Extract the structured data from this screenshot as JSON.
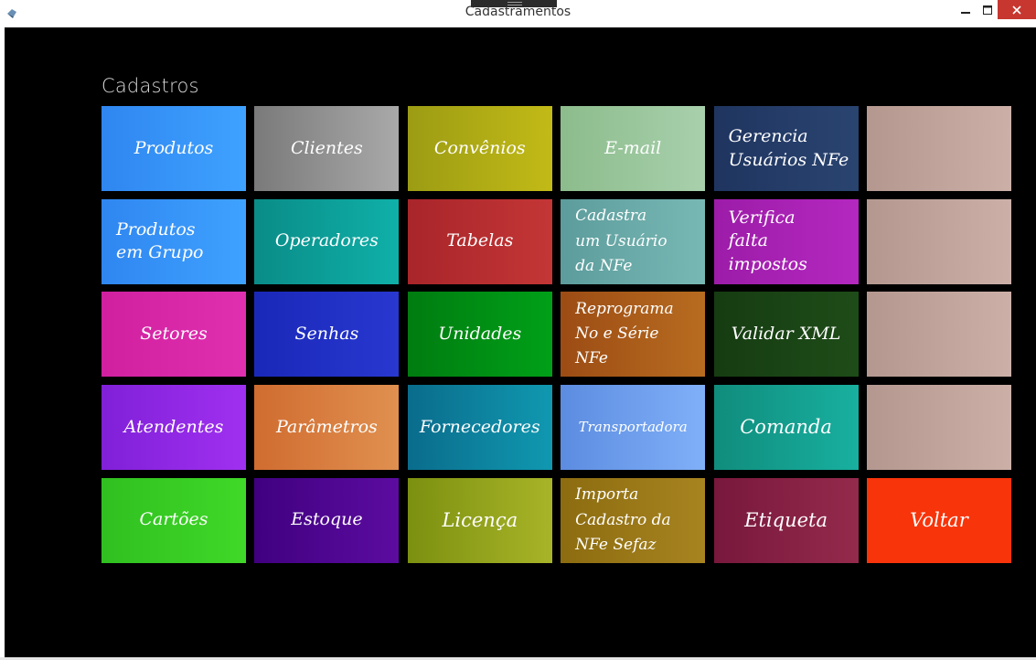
{
  "window": {
    "title": "Cadastramentos"
  },
  "section": {
    "title": "Cadastros"
  },
  "tiles": [
    {
      "label": "Produtos",
      "bg": "linear-gradient(90deg,#2f86f0,#3fa2ff)"
    },
    {
      "label": "Clientes",
      "bg": "linear-gradient(90deg,#7a7a7a,#a9a9a9)"
    },
    {
      "label": "Convênios",
      "bg": "linear-gradient(90deg,#9c9c14,#c2ba16)"
    },
    {
      "label": "E-mail",
      "bg": "linear-gradient(90deg,#8cbc8c,#a8d0ac)"
    },
    {
      "label": "Gerencia\nUsuários NFe",
      "bg": "linear-gradient(90deg,#1f3560,#2a4470)"
    },
    {
      "label": "",
      "bg": "linear-gradient(90deg,#b49890,#ccb0a8)"
    },
    {
      "label": "Produtos\nem Grupo",
      "bg": "linear-gradient(90deg,#2f86f0,#3fa2ff)"
    },
    {
      "label": "Operadores",
      "bg": "linear-gradient(90deg,#0a8c88,#0fb0a8)"
    },
    {
      "label": "Tabelas",
      "bg": "linear-gradient(90deg,#a8252a,#c43636)"
    },
    {
      "label": "Cadastra\num Usuário\nda NFe",
      "bg": "linear-gradient(90deg,#5c9c9c,#78b8b4)"
    },
    {
      "label": "Verifica\nfalta impostos",
      "bg": "linear-gradient(90deg,#9c1ca8,#b428c0)"
    },
    {
      "label": "",
      "bg": "linear-gradient(90deg,#b49890,#ccb0a8)"
    },
    {
      "label": "Setores",
      "bg": "linear-gradient(90deg,#d020a0,#e030b0)"
    },
    {
      "label": "Senhas",
      "bg": "linear-gradient(90deg,#1a28b8,#2838d0)"
    },
    {
      "label": "Unidades",
      "bg": "linear-gradient(90deg,#007c10,#00a018)"
    },
    {
      "label": "Reprograma\nNo e Série NFe",
      "bg": "linear-gradient(90deg,#9c4c14,#b86c20)"
    },
    {
      "label": "Validar XML",
      "bg": "linear-gradient(90deg,#163c12,#1e4c18)"
    },
    {
      "label": "",
      "bg": "linear-gradient(90deg,#b49890,#ccb0a8)"
    },
    {
      "label": "Atendentes",
      "bg": "linear-gradient(90deg,#8020d8,#a030f0)"
    },
    {
      "label": "Parâmetros",
      "bg": "linear-gradient(90deg,#d06c30,#e09050)"
    },
    {
      "label": "Fornecedores",
      "bg": "linear-gradient(90deg,#0a6c8c,#1098b0)"
    },
    {
      "label": "Transportadora",
      "bg": "linear-gradient(90deg,#5c8ce0,#80b0f8)"
    },
    {
      "label": "Comanda",
      "bg": "linear-gradient(90deg,#108c7c,#18b0a0)"
    },
    {
      "label": "",
      "bg": "linear-gradient(90deg,#b49890,#ccb0a8)"
    },
    {
      "label": "Cartões",
      "bg": "linear-gradient(90deg,#30c020,#40d828)"
    },
    {
      "label": "Estoque",
      "bg": "linear-gradient(90deg,#400080,#5c0ca0)"
    },
    {
      "label": "Licença",
      "bg": "linear-gradient(90deg,#7c9010,#a8b428)"
    },
    {
      "label": "Importa\nCadastro da\nNFe Sefaz",
      "bg": "linear-gradient(90deg,#8c6c10,#a88420)"
    },
    {
      "label": "Etiqueta",
      "bg": "linear-gradient(90deg,#78183c,#942a4c)"
    },
    {
      "label": "Voltar",
      "bg": "#f8340a"
    }
  ]
}
